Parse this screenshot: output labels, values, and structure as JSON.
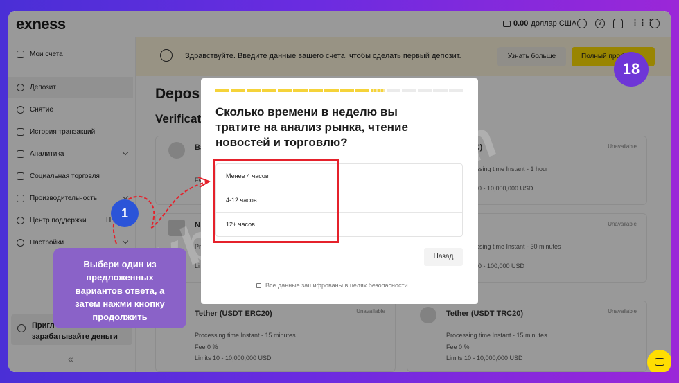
{
  "topbar": {
    "logo": "exness",
    "balance_amount": "0.00",
    "balance_currency": "доллар США"
  },
  "sidebar": {
    "items": [
      {
        "label": "Мои счета"
      },
      {
        "label": "Депозит"
      },
      {
        "label": "Снятие"
      },
      {
        "label": "История транзакций"
      },
      {
        "label": "Аналитика"
      },
      {
        "label": "Социальная торговля"
      },
      {
        "label": "Производительность"
      },
      {
        "label": "Центр поддержки",
        "suffix": "Н"
      },
      {
        "label": "Настройки"
      }
    ],
    "invite_line1": "Пригл",
    "invite_line2": "зарабатывайте деньги",
    "collapse": "«"
  },
  "banner": {
    "text": "Здравствуйте. Введите данные вашего счета, чтобы сделать первый депозит.",
    "learn_more": "Узнать больше",
    "full_btn": "Полный проф"
  },
  "main": {
    "title": "Depos",
    "subtitle": "Verificat"
  },
  "cards": [
    {
      "name": "Ba",
      "unavailable": "Unavailable",
      "l1": "Fe",
      "l2": ""
    },
    {
      "name": "TC)",
      "unavailable": "Unavailable",
      "l1": "cessing time Instant - 1 hour",
      "l2": "s 10 - 10,000,000 USD"
    },
    {
      "name": "N",
      "unavailable": "",
      "l1": "Pr",
      "l2": "Li"
    },
    {
      "name": "",
      "unavailable": "Unavailable",
      "l1": "cessing time Instant - 30 minutes",
      "l2": "s 10 - 100,000 USD"
    },
    {
      "name": "Tether (USDT ERC20)",
      "unavailable": "Unavailable",
      "l1": "Processing time Instant - 15 minutes",
      "l2": "Fee 0 %",
      "l3": "Limits 10 - 10,000,000 USD"
    },
    {
      "name": "Tether (USDT TRC20)",
      "unavailable": "Unavailable",
      "l1": "Processing time Instant - 15 minutes",
      "l2": "Fee 0 %",
      "l3": "Limits 10 - 10,000,000 USD"
    }
  ],
  "modal": {
    "progress_done": 10,
    "progress_total": 16,
    "question": "Сколько времени в неделю вы тратите на анализ рынка, чтение новостей и торговлю?",
    "options": [
      "Менее 4 часов",
      "4-12 часов",
      "12+ часов"
    ],
    "back": "Назад",
    "secure": "Все данные зашифрованы в целях безопасности"
  },
  "tutorial": {
    "step": "18",
    "badge": "1",
    "hint": "Выбери один из предложенных вариантов ответа, а затем нажми кнопку продолжить",
    "watermark": "mmybrokers.com"
  },
  "colors": {
    "accent": "#ffde02",
    "highlight": "#e5212b",
    "badge": "#2b54d8",
    "hint_bg": "#8a62c8"
  }
}
